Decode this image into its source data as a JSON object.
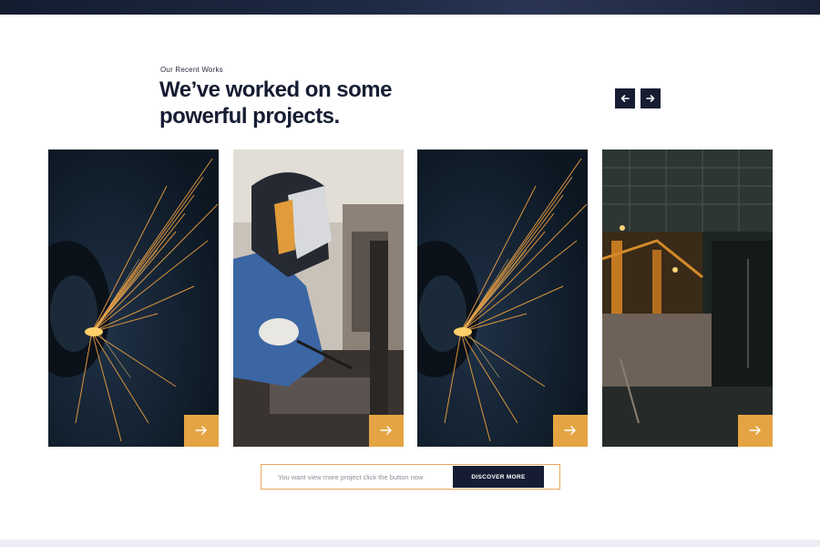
{
  "section": {
    "eyebrow": "Our Recent Works",
    "headline": "We’ve worked on some powerful projects."
  },
  "carousel": {
    "prev_icon": "arrow-left-icon",
    "next_icon": "arrow-right-icon"
  },
  "projects": [
    {
      "image": "grinding-sparks-photo",
      "link_icon": "arrow-right-icon"
    },
    {
      "image": "welder-mask-photo",
      "link_icon": "arrow-right-icon"
    },
    {
      "image": "grinding-sparks-photo",
      "link_icon": "arrow-right-icon"
    },
    {
      "image": "industrial-plant-photo",
      "link_icon": "arrow-right-icon"
    }
  ],
  "cta": {
    "text": "You want view more project click the button now",
    "button_label": "DISCOVER MORE"
  },
  "colors": {
    "navy": "#161d33",
    "accent_orange": "#e4a444",
    "cta_border": "#e9a75a"
  }
}
